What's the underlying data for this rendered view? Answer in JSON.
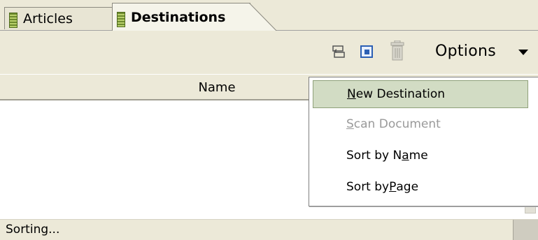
{
  "tabs": [
    {
      "label": "Articles",
      "active": false
    },
    {
      "label": "Destinations",
      "active": true
    }
  ],
  "toolbar": {
    "icons": [
      "refresh-icon",
      "new-destination-icon",
      "trash-icon"
    ],
    "options_label": "Options",
    "options_arrow": "chevron-down-icon"
  },
  "list": {
    "columns": [
      "Name"
    ]
  },
  "menu": {
    "items": [
      {
        "label": "New Destination",
        "mnemonic": "N",
        "rest": "ew Destination",
        "state": "highlighted"
      },
      {
        "label": "Scan Document",
        "mnemonic": "S",
        "rest": "can Document",
        "state": "disabled"
      },
      {
        "label": "Sort by Name",
        "prefix": "Sort by N",
        "mnemonic": "a",
        "rest": "me",
        "state": "enabled"
      },
      {
        "label": "Sort by Page",
        "prefix": "Sort by ",
        "mnemonic": "P",
        "rest": "age",
        "state": "enabled"
      }
    ]
  },
  "status": {
    "text": "Sorting..."
  },
  "colors": {
    "chrome": "#ece9d8",
    "menu_highlight": "#d2dcc4",
    "disabled_text": "#9a9a9a"
  }
}
